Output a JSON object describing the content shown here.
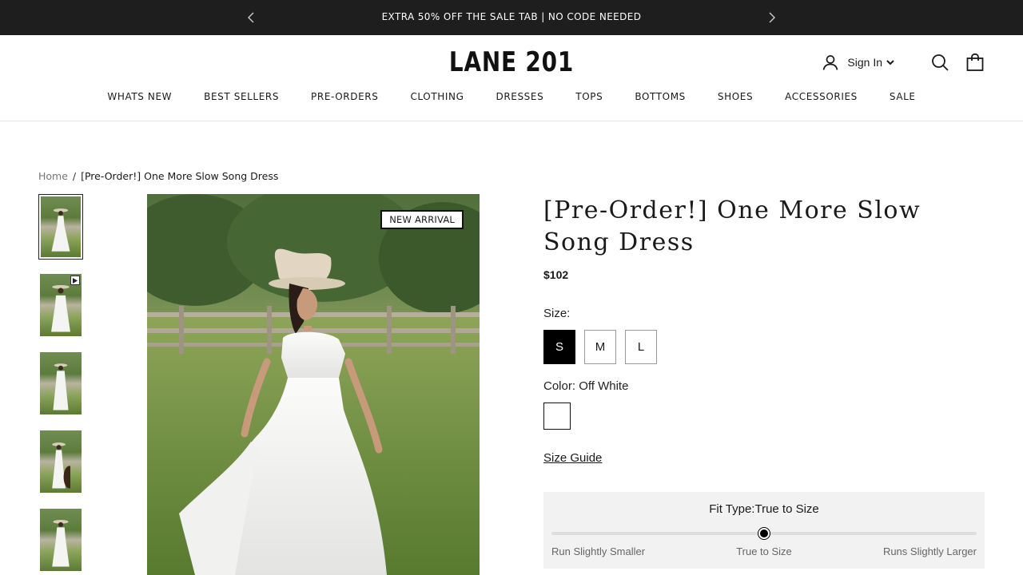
{
  "announcement": {
    "text": "EXTRA 50% OFF THE SALE TAB | NO CODE NEEDED",
    "prev_icon": "chevron-left-icon",
    "next_icon": "chevron-right-icon"
  },
  "header": {
    "logo": "LANE 201",
    "sign_in": "Sign In",
    "icons": [
      "user-icon",
      "chevron-down-icon",
      "search-icon",
      "shopping-bag-icon"
    ]
  },
  "nav": {
    "items": [
      "WHATS NEW",
      "BEST SELLERS",
      "PRE-ORDERS",
      "CLOTHING",
      "DRESSES",
      "TOPS",
      "BOTTOMS",
      "SHOES",
      "ACCESSORIES",
      "SALE"
    ]
  },
  "breadcrumb": {
    "home": "Home",
    "separator": "/",
    "current": "[Pre-Order!] One More Slow Song Dress"
  },
  "gallery": {
    "badge": "NEW ARRIVAL",
    "thumbnail_count": 5,
    "active_thumbnail": 1,
    "video_thumbnail": 2
  },
  "product": {
    "title": "[Pre-Order!] One More Slow Song Dress",
    "price": "$102",
    "size_label": "Size:",
    "sizes": [
      "S",
      "M",
      "L"
    ],
    "selected_size": "S",
    "color_label": "Color:",
    "color_value": "Off White",
    "color_swatch": "#ffffff",
    "size_guide": "Size Guide"
  },
  "fit": {
    "title": "Fit Type:True to Size",
    "scale": [
      "Run Slightly Smaller",
      "True to Size",
      "Runs Slightly Larger"
    ],
    "position_fraction": 0.5
  },
  "colors": {
    "announcement_bg": "#1e1e1e",
    "selected_size_bg": "#000000",
    "fit_box_bg": "#f2f2f2"
  }
}
